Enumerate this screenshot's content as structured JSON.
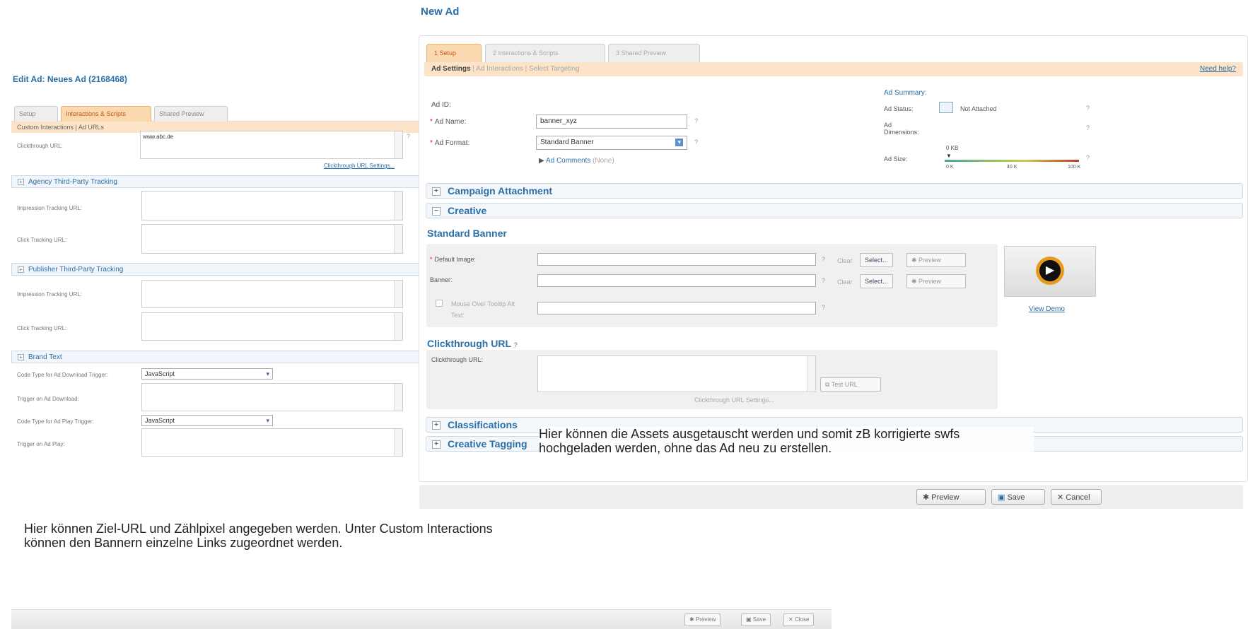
{
  "left": {
    "title": "Edit Ad: Neues Ad (2168468)",
    "tabs": [
      "Setup",
      "Interactions & Scripts",
      "Shared Preview"
    ],
    "subtabs": "Custom Interactions  |  Ad URLs",
    "clickthrough_label": "Clickthrough URL:",
    "clickthrough_value": "www.abc.de",
    "clickthrough_settings": "Clickthrough URL Settings...",
    "agency_section": "Agency Third-Party Tracking",
    "impression_label": "Impression Tracking URL:",
    "click_label": "Click Tracking URL:",
    "publisher_section": "Publisher Third-Party Tracking",
    "brand_section": "Brand Text",
    "code_type_download_label": "Code Type for Ad Download Trigger:",
    "code_type_download_value": "JavaScript",
    "trigger_download_label": "Trigger on Ad Download:",
    "code_type_play_label": "Code Type for Ad Play Trigger:",
    "code_type_play_value": "JavaScript",
    "trigger_play_label": "Trigger on Ad Play:",
    "buttons": {
      "preview": "Preview",
      "save": "Save",
      "close": "Close"
    }
  },
  "right": {
    "title": "New Ad",
    "tabs": [
      "1  Setup",
      "2  Interactions & Scripts",
      "3  Shared Preview"
    ],
    "subtab_active": "Ad Settings",
    "subtab_2": "Ad Interactions",
    "subtab_3": "Select Targeting",
    "need_help": "Need help?",
    "ad_id_label": "Ad ID:",
    "ad_name_label": "Ad Name:",
    "ad_name_value": "banner_xyz",
    "ad_format_label": "Ad Format:",
    "ad_format_value": "Standard Banner",
    "ad_comments": "Ad Comments",
    "ad_comments_none": "(None)",
    "summary": {
      "title": "Ad Summary:",
      "status_label": "Ad Status:",
      "status_value": "Not Attached",
      "dimensions_label": "Ad Dimensions:",
      "size_label": "Ad Size:",
      "size_value": "0 KB",
      "scale": [
        "0 K",
        "40 K",
        "100 K"
      ]
    },
    "campaign_section": "Campaign Attachment",
    "creative_section": "Creative",
    "standard_banner": "Standard Banner",
    "default_image_label": "Default Image:",
    "banner_label": "Banner:",
    "mouseover_label": "Mouse Over Tooltip Alt Text:",
    "clear": "Clear",
    "select": "Select...",
    "preview": "Preview",
    "view_demo": "View Demo",
    "clickthrough_heading": "Clickthrough URL",
    "clickthrough_label": "Clickthrough URL:",
    "test_url": "Test URL",
    "clickthrough_settings": "Clickthrough URL Settings...",
    "classifications_section": "Classifications",
    "creative_tagging_section": "Creative Tagging",
    "buttons": {
      "preview": "Preview",
      "save": "Save",
      "cancel": "Cancel"
    }
  },
  "annotations": {
    "right": "Hier können die Assets ausgetauscht werden und somit zB korrigierte swfs hochgeladen werden, ohne das Ad neu zu erstellen.",
    "left": "Hier können Ziel-URL und Zählpixel angegeben werden. Unter Custom Interactions können den Bannern einzelne Links zugeordnet werden."
  },
  "colors": {
    "accent_blue": "#2a6fa8",
    "tab_orange": "#fbd9b0",
    "required_red": "#d02020"
  }
}
